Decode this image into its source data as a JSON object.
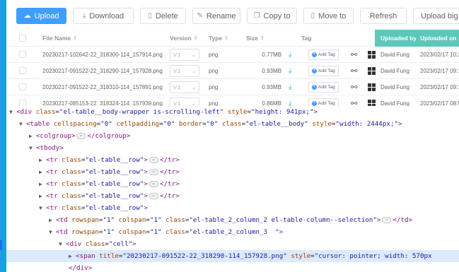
{
  "toolbar": {
    "buttons": [
      {
        "label": "Upload",
        "icon": "cloud-upload-icon"
      },
      {
        "label": "Download",
        "icon": "download-icon"
      },
      {
        "label": "Delete",
        "icon": "file-icon"
      },
      {
        "label": "Rename",
        "icon": "edit-icon"
      },
      {
        "label": "Copy to",
        "icon": "copy-icon"
      },
      {
        "label": "Move to",
        "icon": "file-icon"
      },
      {
        "label": "Refresh",
        "icon": ""
      },
      {
        "label": "Upload big File",
        "icon": ""
      }
    ]
  },
  "table": {
    "headers": {
      "file_name": "File Name",
      "version": "Version",
      "type": "Type",
      "size": "Size",
      "tag": "Tag",
      "uploaded_by": "Uploaded by",
      "uploaded_on": "Uploaded on"
    },
    "add_tag_label": "Add Tag",
    "rows": [
      {
        "name": "20230217-102642-22_318300-114_157914.png",
        "version": "V.1",
        "type": "png",
        "size": "0.77MB",
        "uploaded_by": "David Fung",
        "uploaded_on": "2023/02/17 10:2"
      },
      {
        "name": "20230217-091522-22_318290-114_157928.png",
        "version": "V.1",
        "type": "png",
        "size": "0.93MB",
        "uploaded_by": "David Fung",
        "uploaded_on": "2023/02/17 09:1"
      },
      {
        "name": "20230217-091522-22_318310-114_157891.png",
        "version": "V.1",
        "type": "png",
        "size": "0.93MB",
        "uploaded_by": "David Fung",
        "uploaded_on": "2023/02/17 09:1"
      },
      {
        "name": "20230217-085153-22_318324-114_157939.png",
        "version": "V.1",
        "type": "png",
        "size": "0.86MB",
        "uploaded_by": "David Fung",
        "uploaded_on": "2023/02/17 08:5"
      }
    ]
  },
  "devtools": {
    "l0": {
      "tag": "div",
      "a1n": "class",
      "a1v": "el-table__body-wrapper is-scrolling-left",
      "a2n": "style",
      "a2v": "height: 941px;"
    },
    "l1": {
      "tag": "table",
      "a1n": "cellspacing",
      "a1v": "0",
      "a2n": "cellpadding",
      "a2v": "0",
      "a3n": "border",
      "a3v": "0",
      "a4n": "class",
      "a4v": "el-table__body",
      "a5n": "style",
      "a5v": "width: 2444px;"
    },
    "l2": {
      "open": "colgroup",
      "close": "colgroup"
    },
    "l3": {
      "tag": "tbody"
    },
    "row_tr": {
      "tag": "tr",
      "an": "class",
      "av": "el-table__row",
      "close": "tr"
    },
    "l8": {
      "tag": "tr",
      "an": "class",
      "av": "el-table__row"
    },
    "l9": {
      "tag": "td",
      "a1n": "rowspan",
      "a1v": "1",
      "a2n": "colspan",
      "a2v": "1",
      "a3n": "class",
      "a3v": "el-table_2_column_2  el-table-column--selection",
      "close": "td"
    },
    "l10": {
      "tag": "td",
      "a1n": "rowspan",
      "a1v": "1",
      "a2n": "colspan",
      "a2v": "1",
      "a3n": "class",
      "a3v": "el-table_2_column_3  "
    },
    "l11": {
      "tag": "div",
      "an": "class",
      "av": "cell"
    },
    "l12": {
      "tag": "span",
      "a1n": "title",
      "a1v": "20230217-091522-22_318290-114_157928.png",
      "a2n": "style",
      "a2v": "cursor: pointer; width: 570px"
    },
    "l13": {
      "close": "div"
    }
  }
}
